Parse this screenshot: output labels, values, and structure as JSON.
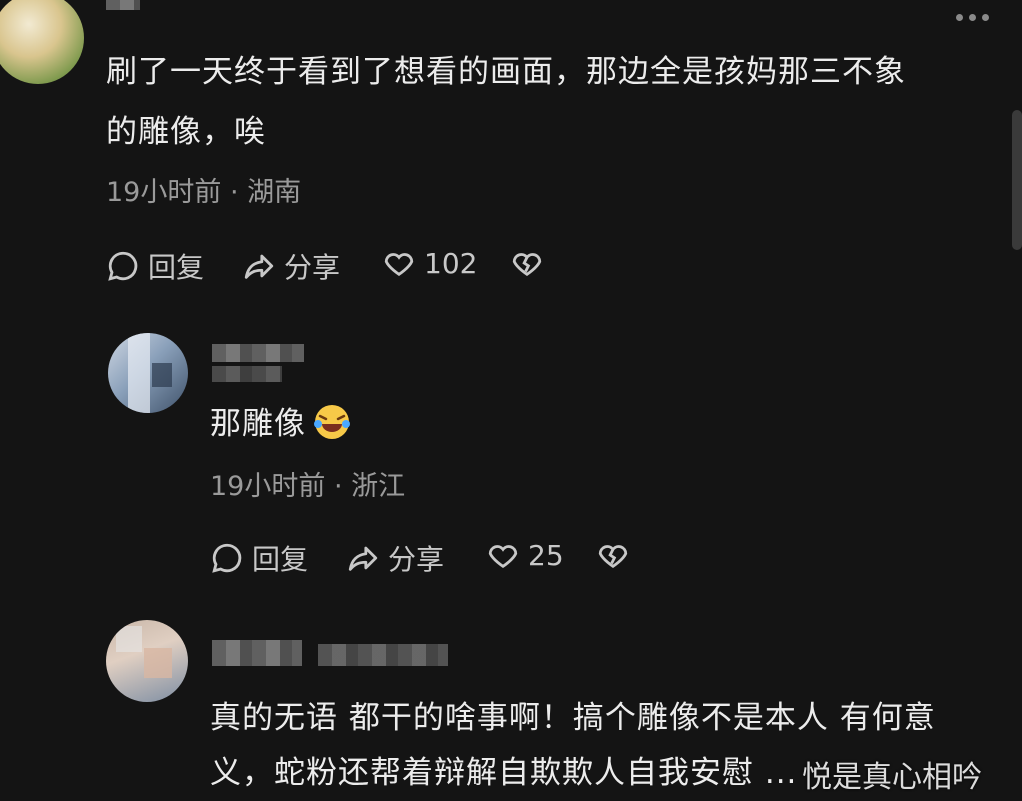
{
  "comments": [
    {
      "text_line1": "刷了一天终于看到了想看的画面，那边全是孩妈那三不象",
      "text_line2": "的雕像，唉",
      "meta": "19小时前 · 湖南",
      "reply_label": "回复",
      "share_label": "分享",
      "likes": "102"
    },
    {
      "text": "那雕像",
      "meta": "19小时前 · 浙江",
      "reply_label": "回复",
      "share_label": "分享",
      "likes": "25"
    },
    {
      "text_line1": "真的无语 都干的啥事啊！搞个雕像不是本人 有何意",
      "text_line2": "义，蛇粉还帮着辩解自欺欺人自我安慰 ..."
    }
  ],
  "watermark": "悦是真心相吟",
  "icons": {
    "reply": "comment-bubble-icon",
    "share": "share-arrow-icon",
    "like": "heart-icon",
    "dislike": "broken-heart-icon",
    "more": "more-dots-icon",
    "emoji": "crying-laughing-emoji"
  }
}
